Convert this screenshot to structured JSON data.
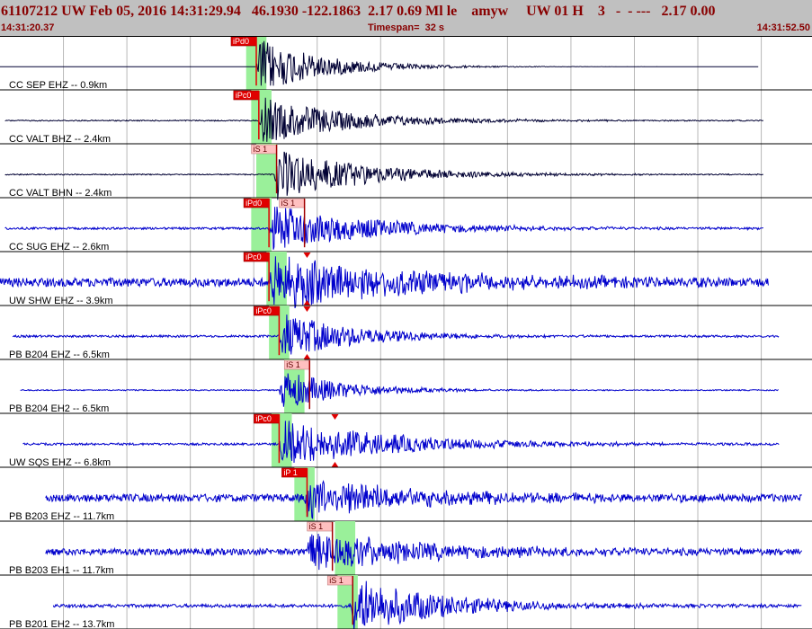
{
  "header": {
    "title": "61107212 UW Feb 05, 2016 14:31:29.94   46.1930 -122.1863  2.17 0.69 Ml le    amyw     UW 01 H    3   -  - ---   2.17 0.00",
    "start_time": "14:31:20.37",
    "timespan": "Timespan=  32 s",
    "end_time": "14:31:52.50"
  },
  "colors": {
    "header_bg": "#c0c0c0",
    "header_text": "#880000",
    "trace_blue": "#0000cc",
    "trace_dark": "#000033",
    "pick_window": "#9af09a",
    "p_pick": "#e00000",
    "s_pick_flag": "#ffc0c0"
  },
  "chart_data": {
    "type": "line",
    "x_unit": "seconds after 14:31:20.37",
    "xlim": [
      0,
      32
    ],
    "vertical_grid_step_s": 2.5,
    "channels": [
      {
        "label": "CC SEP EHZ -- 0.9km",
        "trace_start_s": 0.0,
        "trace_end_s": 29.9,
        "onset_s": 10.1,
        "amplitude": 0.55,
        "noise": 0.0,
        "decay_s": 2.5,
        "dark": true,
        "window_s": [
          9.7,
          10.5
        ],
        "picks": [
          {
            "label": "iPd0",
            "kind": "P",
            "time_s": 10.1
          }
        ]
      },
      {
        "label": "CC VALT BHZ -- 2.4km",
        "trace_start_s": 0.2,
        "trace_end_s": 30.1,
        "onset_s": 10.2,
        "amplitude": 0.45,
        "noise": 0.01,
        "decay_s": 3.5,
        "dark": true,
        "window_s": [
          9.9,
          10.7
        ],
        "picks": [
          {
            "label": "iPc0",
            "kind": "P",
            "time_s": 10.2
          }
        ]
      },
      {
        "label": "CC VALT BHN -- 2.4km",
        "trace_start_s": 0.2,
        "trace_end_s": 30.1,
        "onset_s": 10.8,
        "amplitude": 0.5,
        "noise": 0.01,
        "decay_s": 3.5,
        "dark": true,
        "window_s": [
          10.1,
          10.9
        ],
        "picks": [
          {
            "label": "iS 1",
            "kind": "S",
            "time_s": 10.9
          }
        ]
      },
      {
        "label": "CC SUG EHZ -- 2.6km",
        "trace_start_s": 0.2,
        "trace_end_s": 30.1,
        "onset_s": 10.6,
        "amplitude": 0.45,
        "noise": 0.02,
        "decay_s": 4.0,
        "dark": false,
        "window_s": [
          9.9,
          10.7
        ],
        "picks": [
          {
            "label": "iPd0",
            "kind": "P",
            "time_s": 10.6
          },
          {
            "label": "iS 1",
            "kind": "S",
            "time_s": 12.0
          }
        ]
      },
      {
        "label": "UW SHW EHZ -- 3.9km",
        "trace_start_s": 0.0,
        "trace_end_s": 30.3,
        "onset_s": 10.6,
        "amplitude": 0.5,
        "noise": 0.08,
        "decay_s": 6.0,
        "dark": false,
        "window_s": [
          10.5,
          11.3
        ],
        "picks": [
          {
            "label": "iPc0",
            "kind": "P",
            "time_s": 10.6
          },
          {
            "label": "",
            "kind": "marker",
            "time_s": 12.1
          }
        ]
      },
      {
        "label": "PB B204 EHZ -- 6.5km",
        "trace_start_s": 0.5,
        "trace_end_s": 30.7,
        "onset_s": 11.0,
        "amplitude": 0.45,
        "noise": 0.02,
        "decay_s": 3.0,
        "dark": false,
        "window_s": [
          10.6,
          11.4
        ],
        "picks": [
          {
            "label": "iPc0",
            "kind": "P",
            "time_s": 11.0
          },
          {
            "label": "",
            "kind": "marker",
            "time_s": 12.1
          }
        ]
      },
      {
        "label": "PB B204 EH2 -- 6.5km",
        "trace_start_s": 0.8,
        "trace_end_s": 30.7,
        "onset_s": 11.0,
        "amplitude": 0.4,
        "noise": 0.01,
        "decay_s": 2.5,
        "dark": false,
        "window_s": [
          11.2,
          12.0
        ],
        "picks": [
          {
            "label": "iS 1",
            "kind": "S",
            "time_s": 12.2
          }
        ]
      },
      {
        "label": "UW SQS EHZ -- 6.8km",
        "trace_start_s": 0.9,
        "trace_end_s": 30.7,
        "onset_s": 11.0,
        "amplitude": 0.45,
        "noise": 0.02,
        "decay_s": 4.5,
        "dark": false,
        "window_s": [
          10.7,
          11.5
        ],
        "picks": [
          {
            "label": "iPc0",
            "kind": "P",
            "time_s": 11.0
          },
          {
            "label": "",
            "kind": "marker",
            "time_s": 13.2
          }
        ]
      },
      {
        "label": "PB B203 EHZ -- 11.7km",
        "trace_start_s": 1.8,
        "trace_end_s": 31.6,
        "onset_s": 12.0,
        "amplitude": 0.4,
        "noise": 0.07,
        "decay_s": 4.5,
        "dark": false,
        "window_s": [
          11.6,
          12.4
        ],
        "picks": [
          {
            "label": "iP 1",
            "kind": "P",
            "time_s": 12.1
          }
        ]
      },
      {
        "label": "PB B203 EH1 -- 11.7km",
        "trace_start_s": 1.8,
        "trace_end_s": 31.6,
        "onset_s": 12.0,
        "amplitude": 0.4,
        "noise": 0.06,
        "decay_s": 4.5,
        "dark": false,
        "window_s": [
          13.2,
          14.0
        ],
        "picks": [
          {
            "label": "iS 1",
            "kind": "S",
            "time_s": 13.1
          }
        ]
      },
      {
        "label": "PB B201 EH2 -- 13.7km",
        "trace_start_s": 2.1,
        "trace_end_s": 31.6,
        "onset_s": 13.8,
        "amplitude": 0.55,
        "noise": 0.03,
        "decay_s": 3.5,
        "dark": false,
        "window_s": [
          13.3,
          14.1
        ],
        "picks": [
          {
            "label": "iS 1",
            "kind": "S",
            "time_s": 13.9
          }
        ]
      }
    ]
  }
}
